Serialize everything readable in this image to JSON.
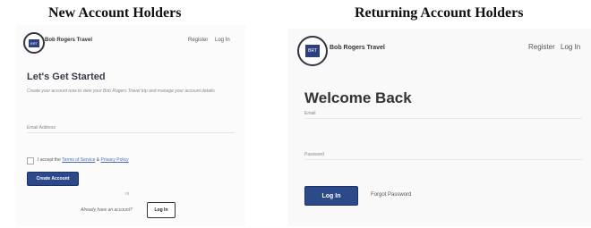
{
  "left": {
    "heading": "New Account Holders",
    "brand": "Bob Rogers Travel",
    "logo_text": "BRT",
    "nav": {
      "register": "Register",
      "login": "Log In"
    },
    "title": "Let's Get Started",
    "description": "Create your account now to view your Bob Rogers Travel trip and manage your account details",
    "email_label": "Email Address",
    "terms": {
      "prefix": "I accept the",
      "tos": "Terms of Service",
      "and": "&",
      "privacy": "Privacy Policy"
    },
    "create_button": "Create Account",
    "or_text": "or",
    "already_text": "Already have an account?",
    "login_button": "Log In"
  },
  "right": {
    "heading": "Returning Account Holders",
    "brand": "Bob Rogers Travel",
    "logo_text": "BRT",
    "nav": {
      "register": "Register",
      "login": "Log In"
    },
    "title": "Welcome Back",
    "email_label": "Email",
    "password_label": "Password",
    "login_button": "Log In",
    "forgot_link": "Forgot Password"
  }
}
